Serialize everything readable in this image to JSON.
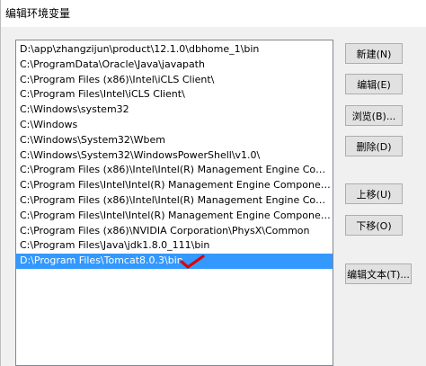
{
  "window": {
    "title": "编辑环境变量"
  },
  "path_list": {
    "items": [
      "D:\\app\\zhangzijun\\product\\12.1.0\\dbhome_1\\bin",
      "C:\\ProgramData\\Oracle\\Java\\javapath",
      "C:\\Program Files (x86)\\Intel\\iCLS Client\\",
      "C:\\Program Files\\Intel\\iCLS Client\\",
      "C:\\Windows\\system32",
      "C:\\Windows",
      "C:\\Windows\\System32\\Wbem",
      "C:\\Windows\\System32\\WindowsPowerShell\\v1.0\\",
      "C:\\Program Files (x86)\\Intel\\Intel(R) Management Engine Compon...",
      "C:\\Program Files\\Intel\\Intel(R) Management Engine Components\\...",
      "C:\\Program Files (x86)\\Intel\\Intel(R) Management Engine Compon...",
      "C:\\Program Files\\Intel\\Intel(R) Management Engine Components\\...",
      "C:\\Program Files (x86)\\NVIDIA Corporation\\PhysX\\Common",
      "C:\\Program Files\\Java\\jdk1.8.0_111\\bin",
      "D:\\Program Files\\Tomcat8.0.3\\bin"
    ],
    "selected_index": 14
  },
  "buttons": {
    "new": "新建(N)",
    "edit": "编辑(E)",
    "browse": "浏览(B)...",
    "delete": "删除(D)",
    "move_up": "上移(U)",
    "move_down": "下移(O)",
    "edit_text": "编辑文本(T)..."
  },
  "colors": {
    "selection": "#3399ff",
    "annotation_check": "#e00000"
  }
}
